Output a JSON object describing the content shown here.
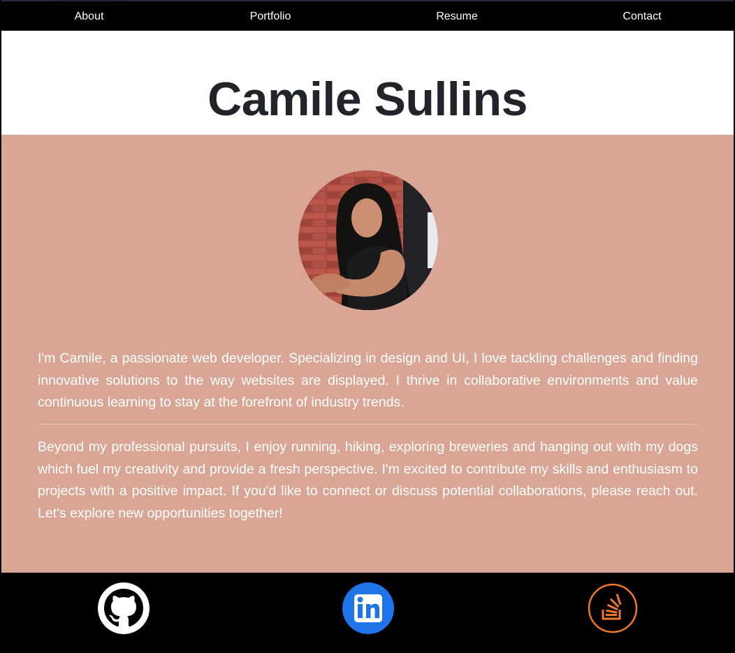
{
  "nav": {
    "items": [
      {
        "label": "About",
        "active": true
      },
      {
        "label": "Portfolio",
        "active": false
      },
      {
        "label": "Resume",
        "active": false
      },
      {
        "label": "Contact",
        "active": false
      }
    ]
  },
  "header": {
    "title": "Camile Sullins"
  },
  "about": {
    "avatar_icon": "profile-photo",
    "bio": [
      "I'm Camile, a passionate web developer. Specializing in design and UI, I love tackling challenges and finding innovative solutions to the way websites are displayed. I thrive in collaborative environments and value continuous learning to stay at the forefront of industry trends.",
      "Beyond my professional pursuits, I enjoy running, hiking, exploring breweries and hanging out with my dogs which fuel my creativity and provide a fresh perspective. I'm excited to contribute my skills and enthusiasm to projects with a positive impact. If you'd like to connect or discuss potential collaborations, please reach out. Let's explore new opportunities together!"
    ]
  },
  "footer": {
    "links": [
      {
        "icon": "github-icon",
        "color": "#ffffff"
      },
      {
        "icon": "linkedin-icon",
        "color": "#1f75e8"
      },
      {
        "icon": "stackoverflow-icon",
        "color": "#f0782a"
      }
    ]
  },
  "colors": {
    "nav_bg": "#000000",
    "section_bg": "#d9a594",
    "title": "#212529",
    "footer_bg": "#000000"
  }
}
